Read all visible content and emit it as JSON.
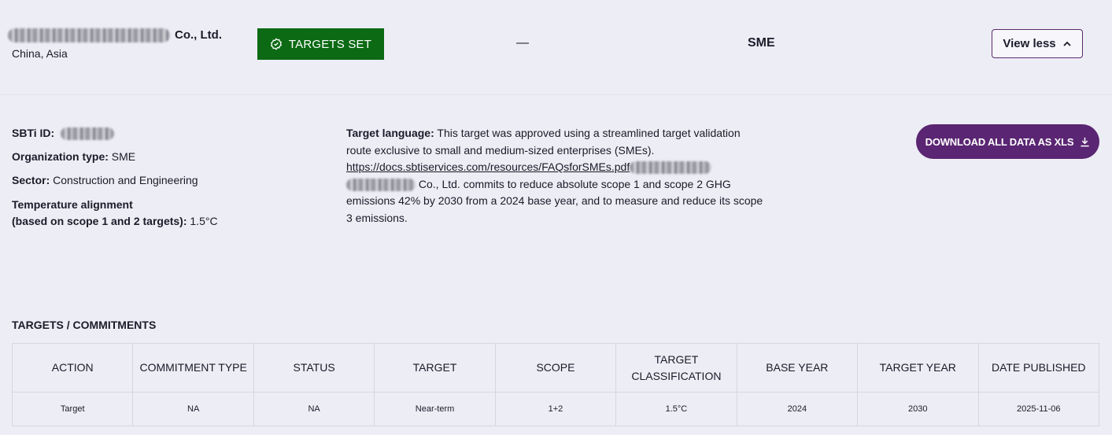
{
  "header": {
    "company_suffix": "Co., Ltd.",
    "location": "China, Asia",
    "status_badge": "TARGETS SET",
    "dash": "—",
    "size": "SME",
    "view_less": "View less"
  },
  "details": {
    "sbti_id_label": "SBTi ID:",
    "org_type_label": "Organization type:",
    "org_type_value": "SME",
    "sector_label": "Sector:",
    "sector_value": "Construction and Engineering",
    "temp_label_1": "Temperature alignment",
    "temp_label_2": "(based on scope 1 and 2 targets):",
    "temp_value": "1.5°C"
  },
  "target_language": {
    "label": "Target language:",
    "text_1": "This target was approved using a streamlined target validation route exclusive to small and medium-sized enterprises (SMEs).",
    "link": "https://docs.sbtiservices.com/resources/FAQsforSMEs.pdf",
    "text_2": "Co., Ltd. commits to reduce absolute scope 1 and scope 2 GHG emissions 42% by 2030 from a 2024 base year, and to measure and reduce its scope 3 emissions."
  },
  "download_button": "DOWNLOAD ALL DATA AS XLS",
  "section_title": "TARGETS / COMMITMENTS",
  "table": {
    "headers": [
      "ACTION",
      "COMMITMENT TYPE",
      "STATUS",
      "TARGET",
      "SCOPE",
      "TARGET CLASSIFICATION",
      "BASE YEAR",
      "TARGET YEAR",
      "DATE PUBLISHED"
    ],
    "rows": [
      [
        "Target",
        "NA",
        "NA",
        "Near-term",
        "1+2",
        "1.5°C",
        "2024",
        "2030",
        "2025-11-06"
      ]
    ]
  },
  "colors": {
    "badge_green": "#0b6a13",
    "brand_purple": "#5a2572",
    "background": "#ededf5"
  },
  "icons": [
    "badge-check-icon",
    "chevron-up-icon",
    "download-icon"
  ]
}
